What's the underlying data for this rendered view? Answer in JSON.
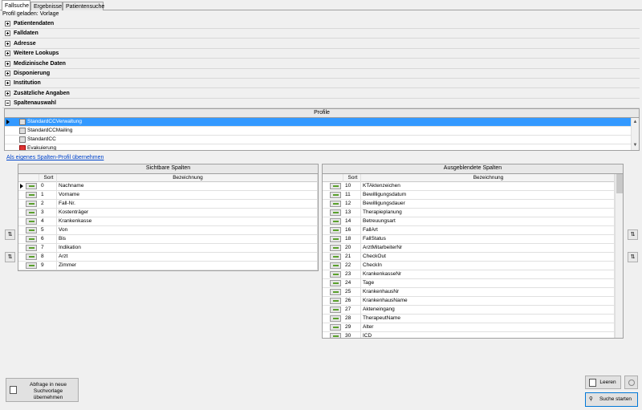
{
  "tabs": [
    {
      "label": "Fallsuche"
    },
    {
      "label": "Ergebnisse"
    },
    {
      "label": "Patientensuche"
    }
  ],
  "profile_loaded": "Profil geladen: Vorlage",
  "sections": [
    {
      "label": "Patientendaten",
      "expanded": false
    },
    {
      "label": "Falldaten",
      "expanded": false
    },
    {
      "label": "Adresse",
      "expanded": false
    },
    {
      "label": "Weitere Lookups",
      "expanded": false
    },
    {
      "label": "Medizinische Daten",
      "expanded": false
    },
    {
      "label": "Disponierung",
      "expanded": false
    },
    {
      "label": "Institution",
      "expanded": false
    },
    {
      "label": "Zusätzliche Angaben",
      "expanded": false
    },
    {
      "label": "Spaltenauswahl",
      "expanded": true
    }
  ],
  "profiles": {
    "header": "Profile",
    "items": [
      {
        "name": "StandardCCVerwaltung",
        "selected": true,
        "icon": "profile-icon"
      },
      {
        "name": "StandardCCMailing",
        "selected": false,
        "icon": "profile-icon"
      },
      {
        "name": "StandardCC",
        "selected": false,
        "icon": "profile-icon"
      },
      {
        "name": "Evakuierung",
        "selected": false,
        "icon": "profile-delete-icon"
      }
    ]
  },
  "own_profile_link": "Als eigenes Spalten-Profil übernehmen",
  "visible_columns": {
    "title": "Sichtbare Spalten",
    "col_sort": "Sort",
    "col_name": "Bezeichnung",
    "rows": [
      {
        "sort": "0",
        "name": "Nachname"
      },
      {
        "sort": "1",
        "name": "Vorname"
      },
      {
        "sort": "2",
        "name": "Fall-Nr."
      },
      {
        "sort": "3",
        "name": "Kostenträger"
      },
      {
        "sort": "4",
        "name": "Krankenkasse"
      },
      {
        "sort": "5",
        "name": "Von"
      },
      {
        "sort": "6",
        "name": "Bis"
      },
      {
        "sort": "7",
        "name": "Indikation"
      },
      {
        "sort": "8",
        "name": "Arzt"
      },
      {
        "sort": "9",
        "name": "Zimmer"
      }
    ]
  },
  "hidden_columns": {
    "title": "Ausgeblendete Spalten",
    "col_sort": "Sort",
    "col_name": "Bezeichnung",
    "rows": [
      {
        "sort": "10",
        "name": "KTAktenzeichen"
      },
      {
        "sort": "11",
        "name": "Bewilligungsdatum"
      },
      {
        "sort": "12",
        "name": "Bewilligungsdauer"
      },
      {
        "sort": "13",
        "name": "Therapieplanung"
      },
      {
        "sort": "14",
        "name": "Betreuungsart"
      },
      {
        "sort": "16",
        "name": "FallArt"
      },
      {
        "sort": "18",
        "name": "FallStatus"
      },
      {
        "sort": "20",
        "name": "ArztMitarbeiterNr"
      },
      {
        "sort": "21",
        "name": "CheckOut"
      },
      {
        "sort": "22",
        "name": "CheckIn"
      },
      {
        "sort": "23",
        "name": "KrankenkasseNr"
      },
      {
        "sort": "24",
        "name": "Tage"
      },
      {
        "sort": "25",
        "name": "KrankenhausNr"
      },
      {
        "sort": "26",
        "name": "KrankenhausName"
      },
      {
        "sort": "27",
        "name": "Akteneingang"
      },
      {
        "sort": "28",
        "name": "TherapeutName"
      },
      {
        "sort": "29",
        "name": "Alter"
      },
      {
        "sort": "30",
        "name": "ICD"
      }
    ]
  },
  "buttons": {
    "apply_template": "Abfrage in neue Suchvorlage übernehmen",
    "clear": "Leeren",
    "search": "Suche starten"
  }
}
